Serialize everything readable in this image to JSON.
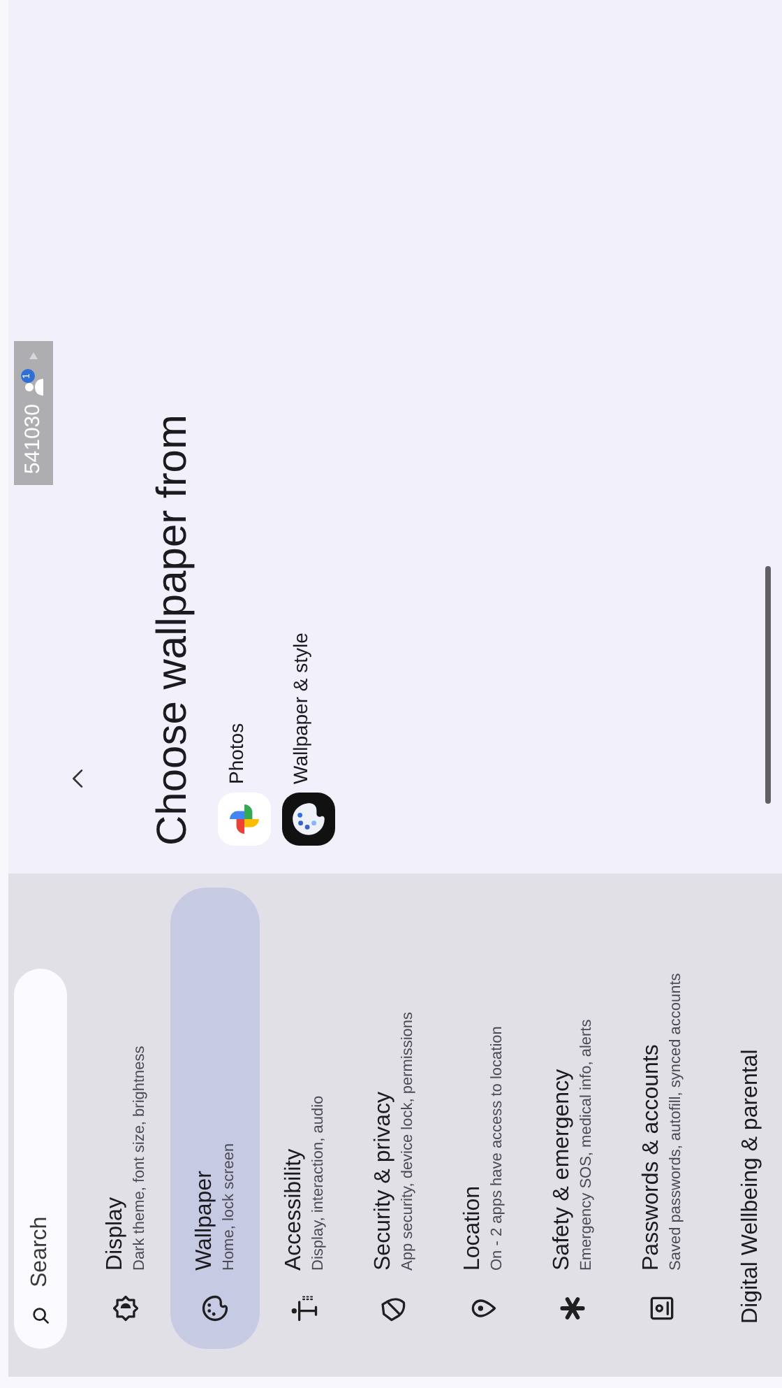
{
  "search": {
    "placeholder": "Search"
  },
  "settings": [
    {
      "title": "Display",
      "subtitle": "Dark theme, font size, brightness",
      "selected": false
    },
    {
      "title": "Wallpaper",
      "subtitle": "Home, lock screen",
      "selected": true
    },
    {
      "title": "Accessibility",
      "subtitle": "Display, interaction, audio",
      "selected": false
    },
    {
      "title": "Security & privacy",
      "subtitle": "App security, device lock, permissions",
      "selected": false
    },
    {
      "title": "Location",
      "subtitle": "On - 2 apps have access to location",
      "selected": false
    },
    {
      "title": "Safety & emergency",
      "subtitle": "Emergency SOS, medical info, alerts",
      "selected": false
    },
    {
      "title": "Passwords & accounts",
      "subtitle": "Saved passwords, autofill, synced accounts",
      "selected": false
    },
    {
      "title": "Digital Wellbeing & parental",
      "selected": false
    }
  ],
  "panel": {
    "title": "Choose wallpaper from",
    "apps": [
      {
        "label": "Photos",
        "kind": "photos"
      },
      {
        "label": "Wallpaper & style",
        "kind": "palette"
      }
    ]
  },
  "user_badge": {
    "id": "541030",
    "count": "1"
  }
}
